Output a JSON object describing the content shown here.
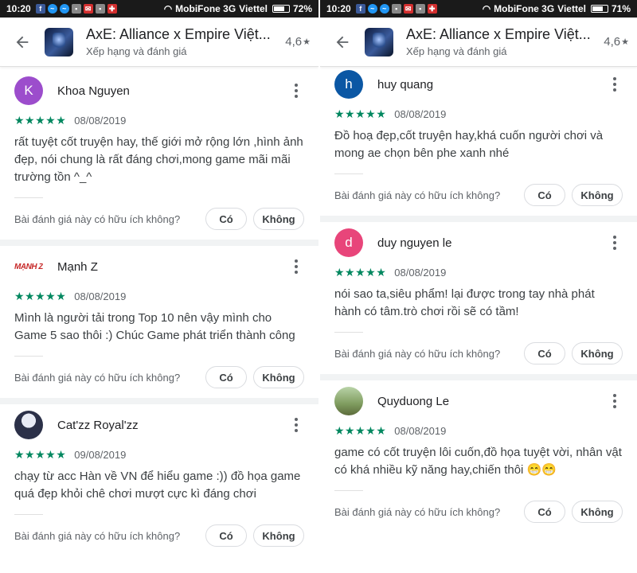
{
  "status_left": {
    "time": "10:20",
    "carrier1": "MobiFone 3G",
    "carrier2": "Viettel",
    "battery": "72%",
    "battery_level": 0.72
  },
  "status_right": {
    "time": "10:20",
    "carrier1": "MobiFone 3G",
    "carrier2": "Viettel",
    "battery": "71%",
    "battery_level": 0.71
  },
  "header": {
    "title": "AxE: Alliance x Empire Việt...",
    "subtitle": "Xếp hạng và đánh giá",
    "rating": "4,6",
    "rating_star": "★"
  },
  "helpful_question": "Bài đánh giá này có hữu ích không?",
  "yes_label": "Có",
  "no_label": "Không",
  "stars": "★★★★★",
  "left_reviews": [
    {
      "name": "Khoa Nguyen",
      "initial": "K",
      "avatar_color": "#9c4dcc",
      "date": "08/08/2019",
      "rating": 5,
      "text": "rất tuyệt cốt truyện hay, thế giới mở rộng lớn ,hình ảnh đẹp, nói chung là rất đáng chơi,mong game mãi mãi trường tồn ^_^"
    },
    {
      "name": "Mạnh Z",
      "initial": "MẠNH Z",
      "avatar_color": "#ffffff",
      "date": "08/08/2019",
      "rating": 5,
      "text": "Mình là người tải trong Top 10 nên vậy mình cho Game 5 sao thôi :) Chúc Game phát triển thành công"
    },
    {
      "name": "Cat'zz Royal'zz",
      "initial": "",
      "avatar_color": "#2b3048",
      "date": "09/08/2019",
      "rating": 5,
      "text": "chạy từ acc Hàn về VN để hiểu game :)) đồ họa game quá đẹp khỏi chê chơi mượt cực kì đáng chơi"
    }
  ],
  "right_reviews": [
    {
      "name": "huy quang",
      "initial": "h",
      "avatar_color": "#0b57a4",
      "date": "08/08/2019",
      "rating": 5,
      "text": "Đồ hoạ đẹp,cốt truyện hay,khá cuốn người chơi và mong ae chọn bên phe xanh nhé"
    },
    {
      "name": "duy nguyen le",
      "initial": "d",
      "avatar_color": "#e8457a",
      "date": "08/08/2019",
      "rating": 5,
      "text": "nói sao ta,siêu phẩm! lại được trong tay nhà phát hành có tâm.trò chơi rồi sẽ có tầm!"
    },
    {
      "name": "Quyduong Le",
      "initial": "",
      "avatar_color": "#7f9c5f",
      "date": "08/08/2019",
      "rating": 5,
      "text": "game có cốt truyện lôi cuốn,đồ họa tuyệt vời, nhân vật có khá nhiều kỹ năng hay,chiến thôi 😁😁"
    }
  ]
}
